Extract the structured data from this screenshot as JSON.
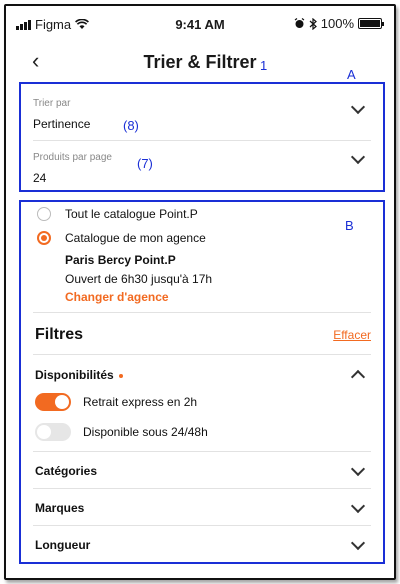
{
  "status_bar": {
    "carrier": "Figma",
    "time": "9:41 AM",
    "battery": "100%",
    "icons": [
      "signal-icon",
      "wifi-icon",
      "alarm-icon",
      "bluetooth-icon",
      "battery-icon"
    ]
  },
  "nav": {
    "title": "Trier & Filtrer",
    "annotation": "1"
  },
  "box_a": {
    "annotation": "A",
    "sort": {
      "label": "Trier par",
      "value": "Pertinence",
      "annotation": "(8)"
    },
    "per_page": {
      "label": "Produits par page",
      "value": "24",
      "annotation": "(7)"
    }
  },
  "box_b": {
    "annotation": "B",
    "scope": {
      "option_all": "Tout le catalogue Point.P",
      "option_agency": "Catalogue de mon agence",
      "selected": "agency"
    },
    "agency": {
      "name": "Paris Bercy Point.P",
      "hours": "Ouvert de 6h30 jusqu'à 17h",
      "change_link": "Changer d'agence"
    },
    "filters": {
      "title": "Filtres",
      "clear_link": "Effacer",
      "availability": {
        "label": "Disponibilités",
        "express": {
          "label": "Retrait express en 2h",
          "on": true
        },
        "within_48h": {
          "label": "Disponible sous 24/48h",
          "on": false
        }
      },
      "categories_label": "Catégories",
      "brands_label": "Marques",
      "length_label": "Longueur"
    }
  },
  "colors": {
    "accent": "#f26a21",
    "annotation": "#1a2fd6"
  }
}
